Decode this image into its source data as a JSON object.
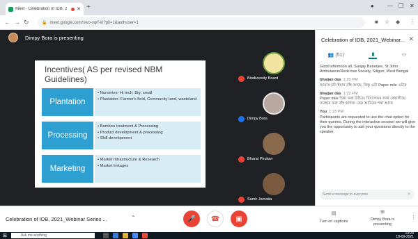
{
  "browser": {
    "tab_title": "Meet - Celebration of IDB, 2",
    "url": "meet.google.com/swo-xqrf-iri?pli=1&authuser=1"
  },
  "presentation": {
    "banner": "Dimpy Bora is presenting",
    "slide": {
      "title": "Incentives( AS per revised NBM Guidelines)",
      "rows": [
        {
          "label": "Plantation",
          "bullets": [
            "Nurseries- Hi tech, Big, small",
            "Plantation- Farmer's field, Community land, wasteland"
          ]
        },
        {
          "label": "Processing",
          "bullets": [
            "Bamboo treatment & Processing",
            "Product development & processing",
            "Skill development"
          ]
        },
        {
          "label": "Marketing",
          "bullets": [
            "Market Infrastructure & Research",
            "Market linkages"
          ]
        }
      ]
    }
  },
  "participants": [
    {
      "name": "Biodiversity Board",
      "mic": "muted"
    },
    {
      "name": "Dimpy Bora",
      "mic": "speaking"
    },
    {
      "name": "Bharat Phukan",
      "mic": "muted"
    },
    {
      "name": "Samir Jamatia",
      "mic": "muted"
    }
  ],
  "chat": {
    "title": "Celebration of IDB, 2021_Webinar...",
    "people_count": "(51)",
    "messages": [
      {
        "sender": "",
        "time": "",
        "text": "Good afternoon all,    Sanjay Banerjee, St John Ambulance/Redcross Society, Siliguri, West Bengal"
      },
      {
        "sender": "bhaijan das",
        "time": "1:20 PM",
        "text": "আমাৰ মনি ইয়ান বাঁহ আছে, কিন্তু এটা Paper mile এটাৰ"
      },
      {
        "sender": "bhaijan das",
        "time": "1:22 PM",
        "text": "Paper mile চিন্তা কৰা উচিত। বিদ্যালয়ৰ লকা ৰেছালীয়ে ব্যবহাৰ কৰা বাঁহ কাগজ তেৱ আমিৰৰ পৰা আছে"
      },
      {
        "sender": "You",
        "time": "1:23 PM",
        "text": "Participants are requested to use the chat option for their queries. During the interactive session we will give you the opportunity to ask your questions directly to the speaker."
      }
    ],
    "input_placeholder": "Send a message to everyone"
  },
  "bottom": {
    "meeting_name": "Celebration of IDB, 2021_Webinar Series ...",
    "captions_label": "Turn on captions",
    "presenting_label": "Dimpy Bora is presenting"
  },
  "taskbar": {
    "search_placeholder": "Ask me anything",
    "time": "13:25",
    "date": "18-09-2021"
  }
}
